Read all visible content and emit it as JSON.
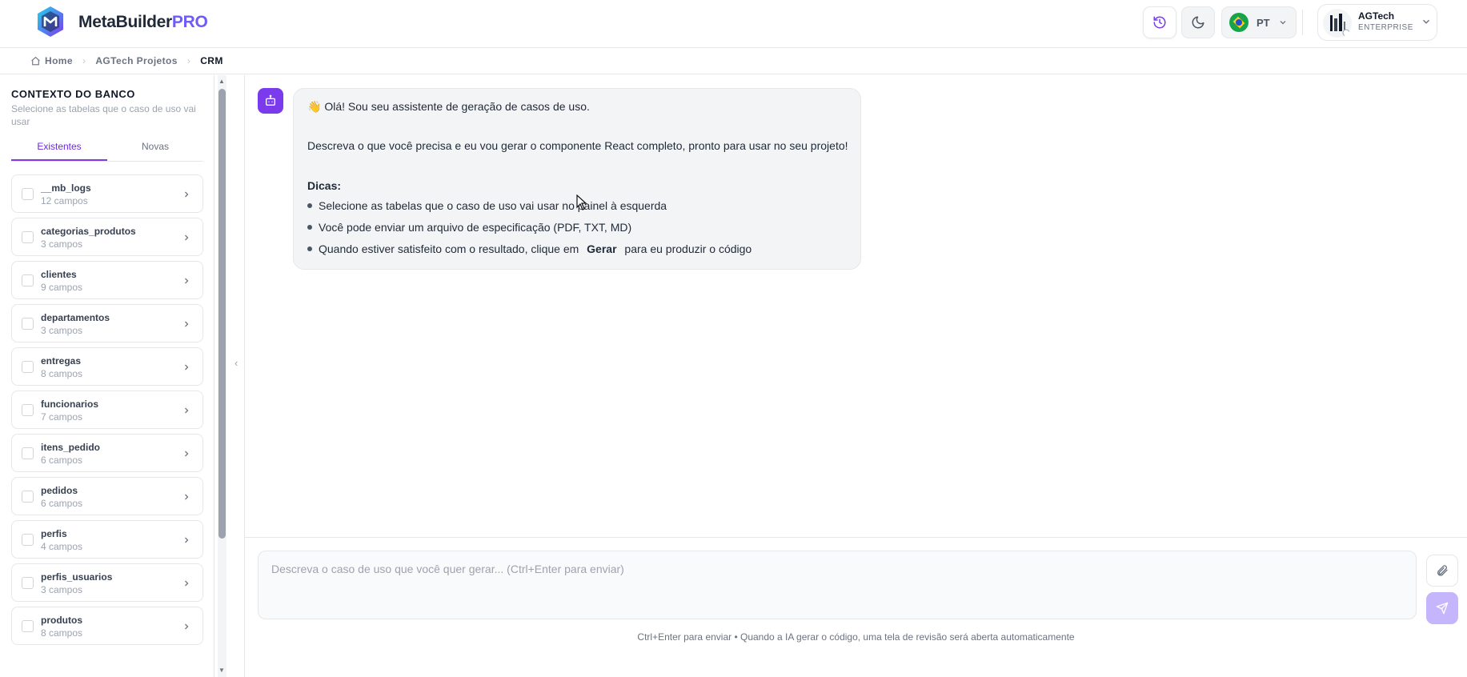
{
  "header": {
    "brand_main": "MetaBuilder",
    "brand_suffix": "PRO",
    "language": "PT",
    "user_name": "AGTech",
    "user_plan": "ENTERPRISE"
  },
  "breadcrumb": [
    "Home",
    "AGTech Projetos",
    "CRM"
  ],
  "sidebar": {
    "title": "CONTEXTO DO BANCO",
    "description": "Selecione as tabelas que o caso de uso vai usar",
    "tabs": [
      "Existentes",
      "Novas"
    ],
    "active_tab": "Existentes",
    "tables": [
      {
        "name": "__mb_logs",
        "fields": "12 campos"
      },
      {
        "name": "categorias_produtos",
        "fields": "3 campos"
      },
      {
        "name": "clientes",
        "fields": "9 campos"
      },
      {
        "name": "departamentos",
        "fields": "3 campos"
      },
      {
        "name": "entregas",
        "fields": "8 campos"
      },
      {
        "name": "funcionarios",
        "fields": "7 campos"
      },
      {
        "name": "itens_pedido",
        "fields": "6 campos"
      },
      {
        "name": "pedidos",
        "fields": "6 campos"
      },
      {
        "name": "perfis",
        "fields": "4 campos"
      },
      {
        "name": "perfis_usuarios",
        "fields": "3 campos"
      },
      {
        "name": "produtos",
        "fields": "8 campos"
      }
    ]
  },
  "chat": {
    "greeting_emoji": "👋",
    "greeting": "Olá! Sou seu assistente de geração de casos de uso.",
    "intro": "Descreva o que você precisa e eu vou gerar o componente React completo, pronto para usar no seu projeto!",
    "tips_title": "Dicas:",
    "tip1": "Selecione as tabelas que o caso de uso vai usar no painel à esquerda",
    "tip2": "Você pode enviar um arquivo de especificação (PDF, TXT, MD)",
    "tip3_before": "Quando estiver satisfeito com o resultado, clique em",
    "tip3_bold": "Gerar",
    "tip3_after": "para eu produzir o código"
  },
  "composer": {
    "placeholder": "Descreva o caso de uso que você quer gerar... (Ctrl+Enter para enviar)",
    "hint": "Ctrl+Enter para enviar • Quando a IA gerar o código, uma tela de revisão será aberta automaticamente"
  },
  "colors": {
    "accent": "#7c3aed",
    "send_disabled": "#c4b5fd"
  },
  "icons": [
    "logo-icon",
    "history-icon",
    "moon-icon",
    "brazil-flag-icon",
    "chevron-down-icon",
    "home-icon",
    "chevron-right-icon",
    "bot-icon",
    "paperclip-icon",
    "send-icon",
    "collapse-sidebar-icon"
  ]
}
